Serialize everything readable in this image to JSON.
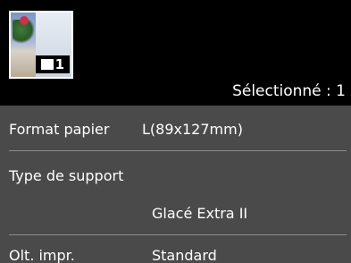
{
  "header": {
    "thumbnail_icon": "photo-thumbnail",
    "copy_count": "1",
    "selected_text": "Sélectionné : 1"
  },
  "settings": [
    {
      "label": "Format papier",
      "value": "L(89x127mm)"
    },
    {
      "label": "Type de support",
      "value": "Glacé Extra II"
    },
    {
      "label": "Olt. impr.",
      "value": "Standard"
    }
  ],
  "colors": {
    "header_bg": "#000000",
    "panel_bg": "#4a4a4a",
    "divider": "#8c8c8c",
    "text": "#ffffff"
  }
}
